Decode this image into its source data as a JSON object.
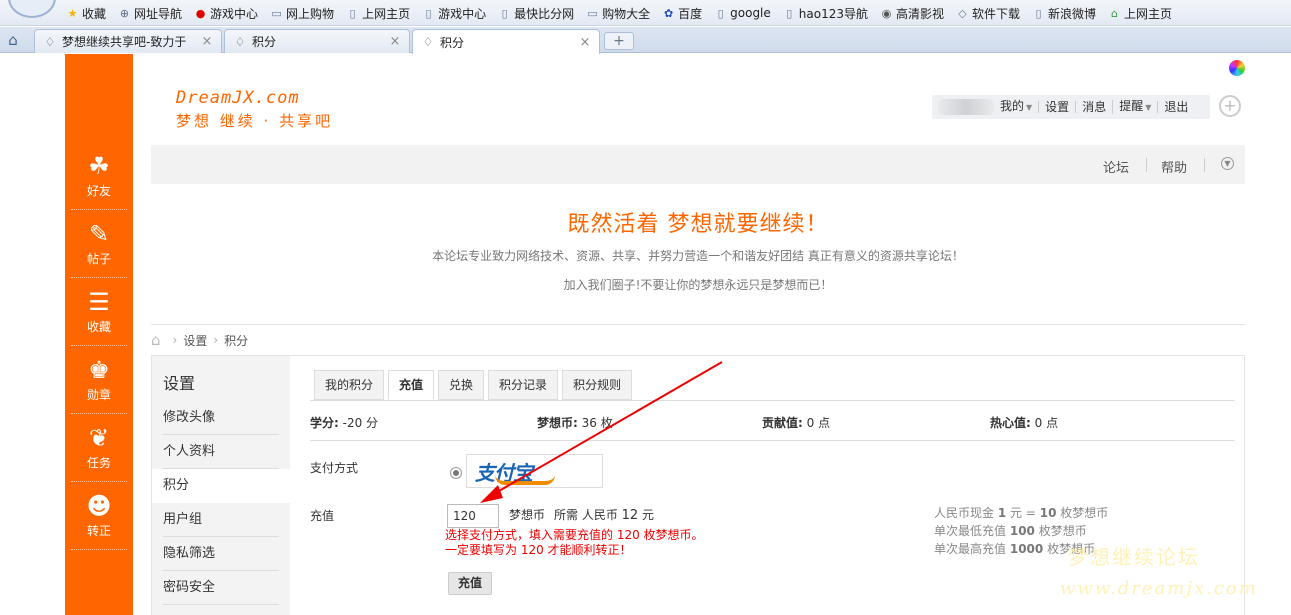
{
  "browser": {
    "bookmarks": [
      {
        "label": "收藏",
        "icon": "star-icon"
      },
      {
        "label": "网址导航",
        "icon": "globe-icon"
      },
      {
        "label": "游戏中心",
        "icon": "game-icon"
      },
      {
        "label": "网上购物",
        "icon": "folder-icon"
      },
      {
        "label": "上网主页",
        "icon": "page-icon"
      },
      {
        "label": "游戏中心",
        "icon": "page-icon"
      },
      {
        "label": "最快比分网",
        "icon": "page-icon"
      },
      {
        "label": "购物大全",
        "icon": "folder-icon"
      },
      {
        "label": "百度",
        "icon": "baidu-icon"
      },
      {
        "label": "google",
        "icon": "page-icon"
      },
      {
        "label": "hao123导航",
        "icon": "page-icon"
      },
      {
        "label": "高清影视",
        "icon": "film-icon"
      },
      {
        "label": "软件下载",
        "icon": "tag-icon"
      },
      {
        "label": "新浪微博",
        "icon": "page-icon"
      },
      {
        "label": "上网主页",
        "icon": "home-page-icon"
      }
    ],
    "tabs": [
      {
        "title": "梦想继续共享吧-致力于",
        "active": false
      },
      {
        "title": "积分",
        "active": false
      },
      {
        "title": "积分",
        "active": true
      }
    ]
  },
  "site": {
    "logo_line1": "DreamJX.com",
    "logo_line2": "梦想 继续 · 共享吧",
    "user_menu": {
      "my": "我的",
      "settings": "设置",
      "messages": "消息",
      "remind": "提醒",
      "logout": "退出"
    },
    "nav": {
      "forum": "论坛",
      "help": "帮助"
    },
    "sidebar": [
      {
        "label": "好友",
        "icon": "friends-icon"
      },
      {
        "label": "帖子",
        "icon": "post-icon"
      },
      {
        "label": "收藏",
        "icon": "favorite-icon"
      },
      {
        "label": "勋章",
        "icon": "medal-icon"
      },
      {
        "label": "任务",
        "icon": "task-icon"
      },
      {
        "label": "转正",
        "icon": "promote-icon"
      }
    ],
    "slogan": "既然活着 梦想就要继续！",
    "desc1": "本论坛专业致力网络技术、资源、共享、并努力营造一个和谐友好团结 真正有意义的资源共享论坛！",
    "desc2": "加入我们圈子!不要让你的梦想永远只是梦想而已！"
  },
  "breadcrumb": [
    "设置",
    "积分"
  ],
  "left_nav": {
    "title": "设置",
    "items": [
      "修改头像",
      "个人资料",
      "积分",
      "用户组",
      "隐私筛选",
      "密码安全"
    ]
  },
  "content_tabs": [
    "我的积分",
    "充值",
    "兑换",
    "积分记录",
    "积分规则"
  ],
  "stats": [
    {
      "label": "学分:",
      "value": "-20 分"
    },
    {
      "label": "梦想币:",
      "value": "36 枚"
    },
    {
      "label": "贡献值:",
      "value": "0 点"
    },
    {
      "label": "热心值:",
      "value": "0 点"
    }
  ],
  "recharge": {
    "pay_label": "支付方式",
    "pay_logo_text": "支付宝",
    "amount_label": "充值",
    "amount_value": "120",
    "unit": "梦想币",
    "need_prefix": "所需 人民币",
    "need_value": "12",
    "need_unit": "元",
    "note1": "选择支付方式，填入需要充值的 120 枚梦想币。",
    "note2": "一定要填写为 120 才能顺利转正！",
    "submit": "充值",
    "rate_lines": [
      {
        "pre": "人民币现金",
        "v1": "1",
        "mid": "元 =",
        "v2": "10",
        "post": "枚梦想币"
      },
      {
        "pre": "单次最低充值",
        "v1": "100",
        "mid": "",
        "v2": "",
        "post": "枚梦想币"
      },
      {
        "pre": "单次最高充值",
        "v1": "1000",
        "mid": "",
        "v2": "",
        "post": "枚梦想币"
      }
    ]
  },
  "watermark": {
    "line1": "梦想继续论坛",
    "line2": "www.dreamjx.com"
  },
  "colors": {
    "brand": "#ff6600",
    "note": "#e00000"
  }
}
